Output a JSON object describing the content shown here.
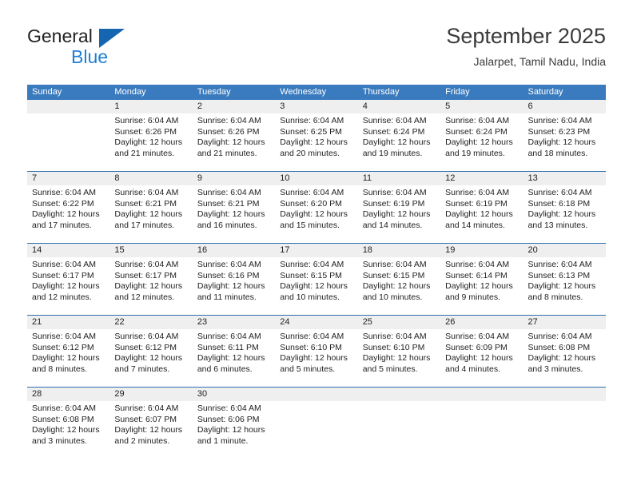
{
  "brand": {
    "name_part1": "General",
    "name_part2": "Blue",
    "triangle_color": "#1565b0",
    "blue_color": "#1f7fd4"
  },
  "header": {
    "title": "September 2025",
    "subtitle": "Jalarpet, Tamil Nadu, India"
  },
  "theme": {
    "header_row_bg": "#3a7bbf",
    "date_band_bg": "#efefef",
    "week_divider": "#2f6fae"
  },
  "weekday_headers": [
    "Sunday",
    "Monday",
    "Tuesday",
    "Wednesday",
    "Thursday",
    "Friday",
    "Saturday"
  ],
  "weeks": [
    {
      "days": [
        {
          "date": "",
          "sunrise": "",
          "sunset": "",
          "daylight": ""
        },
        {
          "date": "1",
          "sunrise": "Sunrise: 6:04 AM",
          "sunset": "Sunset: 6:26 PM",
          "daylight": "Daylight: 12 hours and 21 minutes."
        },
        {
          "date": "2",
          "sunrise": "Sunrise: 6:04 AM",
          "sunset": "Sunset: 6:26 PM",
          "daylight": "Daylight: 12 hours and 21 minutes."
        },
        {
          "date": "3",
          "sunrise": "Sunrise: 6:04 AM",
          "sunset": "Sunset: 6:25 PM",
          "daylight": "Daylight: 12 hours and 20 minutes."
        },
        {
          "date": "4",
          "sunrise": "Sunrise: 6:04 AM",
          "sunset": "Sunset: 6:24 PM",
          "daylight": "Daylight: 12 hours and 19 minutes."
        },
        {
          "date": "5",
          "sunrise": "Sunrise: 6:04 AM",
          "sunset": "Sunset: 6:24 PM",
          "daylight": "Daylight: 12 hours and 19 minutes."
        },
        {
          "date": "6",
          "sunrise": "Sunrise: 6:04 AM",
          "sunset": "Sunset: 6:23 PM",
          "daylight": "Daylight: 12 hours and 18 minutes."
        }
      ]
    },
    {
      "days": [
        {
          "date": "7",
          "sunrise": "Sunrise: 6:04 AM",
          "sunset": "Sunset: 6:22 PM",
          "daylight": "Daylight: 12 hours and 17 minutes."
        },
        {
          "date": "8",
          "sunrise": "Sunrise: 6:04 AM",
          "sunset": "Sunset: 6:21 PM",
          "daylight": "Daylight: 12 hours and 17 minutes."
        },
        {
          "date": "9",
          "sunrise": "Sunrise: 6:04 AM",
          "sunset": "Sunset: 6:21 PM",
          "daylight": "Daylight: 12 hours and 16 minutes."
        },
        {
          "date": "10",
          "sunrise": "Sunrise: 6:04 AM",
          "sunset": "Sunset: 6:20 PM",
          "daylight": "Daylight: 12 hours and 15 minutes."
        },
        {
          "date": "11",
          "sunrise": "Sunrise: 6:04 AM",
          "sunset": "Sunset: 6:19 PM",
          "daylight": "Daylight: 12 hours and 14 minutes."
        },
        {
          "date": "12",
          "sunrise": "Sunrise: 6:04 AM",
          "sunset": "Sunset: 6:19 PM",
          "daylight": "Daylight: 12 hours and 14 minutes."
        },
        {
          "date": "13",
          "sunrise": "Sunrise: 6:04 AM",
          "sunset": "Sunset: 6:18 PM",
          "daylight": "Daylight: 12 hours and 13 minutes."
        }
      ]
    },
    {
      "days": [
        {
          "date": "14",
          "sunrise": "Sunrise: 6:04 AM",
          "sunset": "Sunset: 6:17 PM",
          "daylight": "Daylight: 12 hours and 12 minutes."
        },
        {
          "date": "15",
          "sunrise": "Sunrise: 6:04 AM",
          "sunset": "Sunset: 6:17 PM",
          "daylight": "Daylight: 12 hours and 12 minutes."
        },
        {
          "date": "16",
          "sunrise": "Sunrise: 6:04 AM",
          "sunset": "Sunset: 6:16 PM",
          "daylight": "Daylight: 12 hours and 11 minutes."
        },
        {
          "date": "17",
          "sunrise": "Sunrise: 6:04 AM",
          "sunset": "Sunset: 6:15 PM",
          "daylight": "Daylight: 12 hours and 10 minutes."
        },
        {
          "date": "18",
          "sunrise": "Sunrise: 6:04 AM",
          "sunset": "Sunset: 6:15 PM",
          "daylight": "Daylight: 12 hours and 10 minutes."
        },
        {
          "date": "19",
          "sunrise": "Sunrise: 6:04 AM",
          "sunset": "Sunset: 6:14 PM",
          "daylight": "Daylight: 12 hours and 9 minutes."
        },
        {
          "date": "20",
          "sunrise": "Sunrise: 6:04 AM",
          "sunset": "Sunset: 6:13 PM",
          "daylight": "Daylight: 12 hours and 8 minutes."
        }
      ]
    },
    {
      "days": [
        {
          "date": "21",
          "sunrise": "Sunrise: 6:04 AM",
          "sunset": "Sunset: 6:12 PM",
          "daylight": "Daylight: 12 hours and 8 minutes."
        },
        {
          "date": "22",
          "sunrise": "Sunrise: 6:04 AM",
          "sunset": "Sunset: 6:12 PM",
          "daylight": "Daylight: 12 hours and 7 minutes."
        },
        {
          "date": "23",
          "sunrise": "Sunrise: 6:04 AM",
          "sunset": "Sunset: 6:11 PM",
          "daylight": "Daylight: 12 hours and 6 minutes."
        },
        {
          "date": "24",
          "sunrise": "Sunrise: 6:04 AM",
          "sunset": "Sunset: 6:10 PM",
          "daylight": "Daylight: 12 hours and 5 minutes."
        },
        {
          "date": "25",
          "sunrise": "Sunrise: 6:04 AM",
          "sunset": "Sunset: 6:10 PM",
          "daylight": "Daylight: 12 hours and 5 minutes."
        },
        {
          "date": "26",
          "sunrise": "Sunrise: 6:04 AM",
          "sunset": "Sunset: 6:09 PM",
          "daylight": "Daylight: 12 hours and 4 minutes."
        },
        {
          "date": "27",
          "sunrise": "Sunrise: 6:04 AM",
          "sunset": "Sunset: 6:08 PM",
          "daylight": "Daylight: 12 hours and 3 minutes."
        }
      ]
    },
    {
      "days": [
        {
          "date": "28",
          "sunrise": "Sunrise: 6:04 AM",
          "sunset": "Sunset: 6:08 PM",
          "daylight": "Daylight: 12 hours and 3 minutes."
        },
        {
          "date": "29",
          "sunrise": "Sunrise: 6:04 AM",
          "sunset": "Sunset: 6:07 PM",
          "daylight": "Daylight: 12 hours and 2 minutes."
        },
        {
          "date": "30",
          "sunrise": "Sunrise: 6:04 AM",
          "sunset": "Sunset: 6:06 PM",
          "daylight": "Daylight: 12 hours and 1 minute."
        },
        {
          "date": "",
          "sunrise": "",
          "sunset": "",
          "daylight": ""
        },
        {
          "date": "",
          "sunrise": "",
          "sunset": "",
          "daylight": ""
        },
        {
          "date": "",
          "sunrise": "",
          "sunset": "",
          "daylight": ""
        },
        {
          "date": "",
          "sunrise": "",
          "sunset": "",
          "daylight": ""
        }
      ]
    }
  ]
}
